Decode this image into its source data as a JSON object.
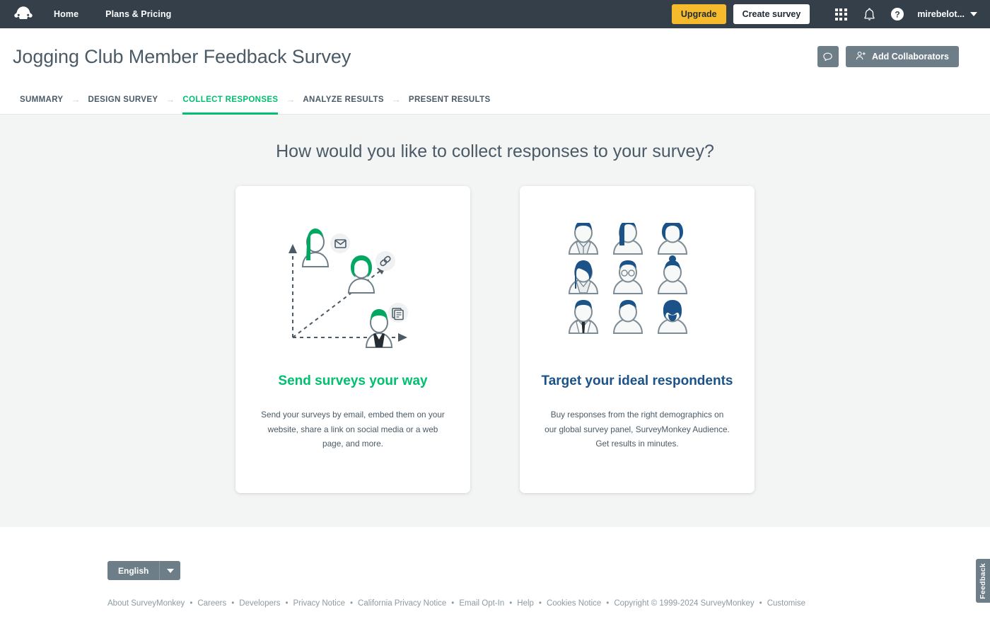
{
  "topnav": {
    "logo_icon": "surveymonkey-logo-icon",
    "links": [
      {
        "label": "Home"
      },
      {
        "label": "Plans & Pricing"
      }
    ],
    "upgrade_label": "Upgrade",
    "create_survey_label": "Create survey",
    "apps_icon": "apps-grid-icon",
    "notifications_icon": "bell-icon",
    "help_icon": "help-circle-icon",
    "username": "mirebelot...",
    "caret_icon": "chevron-down-icon",
    "colors": {
      "bar": "#343f49",
      "upgrade": "#f5bb2d"
    }
  },
  "titlebar": {
    "title": "Jogging Club Member Feedback Survey",
    "comment_icon": "speech-bubble-icon",
    "collaborators_icon": "add-person-icon",
    "collaborators_label": "Add Collaborators"
  },
  "tabs": {
    "separator": "→",
    "items": [
      {
        "label": "SUMMARY",
        "active": false
      },
      {
        "label": "DESIGN SURVEY",
        "active": false
      },
      {
        "label": "COLLECT RESPONSES",
        "active": true
      },
      {
        "label": "ANALYZE RESULTS",
        "active": false
      },
      {
        "label": "PRESENT RESULTS",
        "active": false
      }
    ],
    "active_color": "#00bf6f"
  },
  "main": {
    "heading": "How would you like to collect responses to your survey?",
    "cards": [
      {
        "art_icon": "send-surveys-illustration",
        "title": "Send surveys your way",
        "text": "Send your surveys by email, embed them on your website, share a link on social media or a web page, and more.",
        "title_color": "#00bf6f"
      },
      {
        "art_icon": "respondent-avatars-illustration",
        "title": "Target your ideal respondents",
        "text": "Buy responses from the right demographics on our global survey panel, SurveyMonkey Audience. Get results in minutes.",
        "title_color": "#1b5287"
      }
    ]
  },
  "footer": {
    "language": "English",
    "language_caret_icon": "chevron-down-icon",
    "separator": "•",
    "links": [
      {
        "label": "About SurveyMonkey"
      },
      {
        "label": "Careers"
      },
      {
        "label": "Developers"
      },
      {
        "label": "Privacy Notice"
      },
      {
        "label": "California Privacy Notice"
      },
      {
        "label": "Email Opt-In"
      },
      {
        "label": "Help"
      },
      {
        "label": "Cookies Notice"
      }
    ],
    "copyright": "Copyright © 1999-2024 SurveyMonkey",
    "customise_label": "Customise"
  },
  "feedback_tab": {
    "label": "Feedback"
  }
}
